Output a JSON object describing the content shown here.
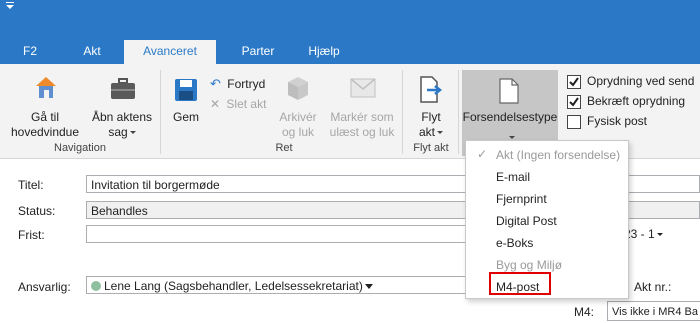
{
  "tabs": [
    {
      "label": "F2"
    },
    {
      "label": "Akt"
    },
    {
      "label": "Avanceret"
    },
    {
      "label": "Parter"
    },
    {
      "label": "Hjælp"
    }
  ],
  "ribbon": {
    "navigation": {
      "goto_main_line1": "Gå til",
      "goto_main_line2": "hovedvindue",
      "open_case_line1": "Åbn aktens",
      "open_case_line2": "sag",
      "group_label": "Navigation"
    },
    "ret": {
      "save": "Gem",
      "undo": "Fortryd",
      "delete": "Slet akt",
      "archive_line1": "Arkivér",
      "archive_line2": "og luk",
      "mark_unread_line1": "Markér som",
      "mark_unread_line2": "ulæst og luk",
      "group_label": "Ret"
    },
    "flyt": {
      "move_line1": "Flyt",
      "move_line2": "akt",
      "group_label": "Flyt akt"
    },
    "forsendelse": {
      "label": "Forsendelsestype"
    },
    "checkboxes": [
      {
        "label": "Oprydning ved send",
        "checked": true
      },
      {
        "label": "Bekræft oprydning",
        "checked": true
      },
      {
        "label": "Fysisk post",
        "checked": false
      }
    ]
  },
  "form": {
    "title_label": "Titel:",
    "title_value": "Invitation til borgermøde",
    "status_label": "Status:",
    "status_value": "Behandles",
    "deadline_label": "Frist:",
    "deadline_partial": "23 - 1",
    "responsible_label": "Ansvarlig:",
    "responsible_value": "Lene Lang (Sagsbehandler, Ledelsessekretariat)",
    "akt_nr_label": "Akt nr.:",
    "m4_label": "M4:",
    "m4_value": "Vis ikke i MR4 Ba"
  },
  "dropdown": {
    "items": [
      {
        "label": "Akt (Ingen forsendelse)",
        "checked": true,
        "disabled": true
      },
      {
        "label": "E-mail",
        "checked": false,
        "disabled": false
      },
      {
        "label": "Fjernprint",
        "checked": false,
        "disabled": false
      },
      {
        "label": "Digital Post",
        "checked": false,
        "disabled": false
      },
      {
        "label": "e-Boks",
        "checked": false,
        "disabled": false
      },
      {
        "label": "Byg og Miljø",
        "checked": false,
        "disabled": true
      },
      {
        "label": "M4-post",
        "checked": false,
        "disabled": false
      }
    ]
  },
  "colors": {
    "titlebar": "#2b79c6",
    "ribbon": "#f3f3f3",
    "highlight": "#e00000",
    "forsendelse_pressed": "#c6c6c6"
  }
}
